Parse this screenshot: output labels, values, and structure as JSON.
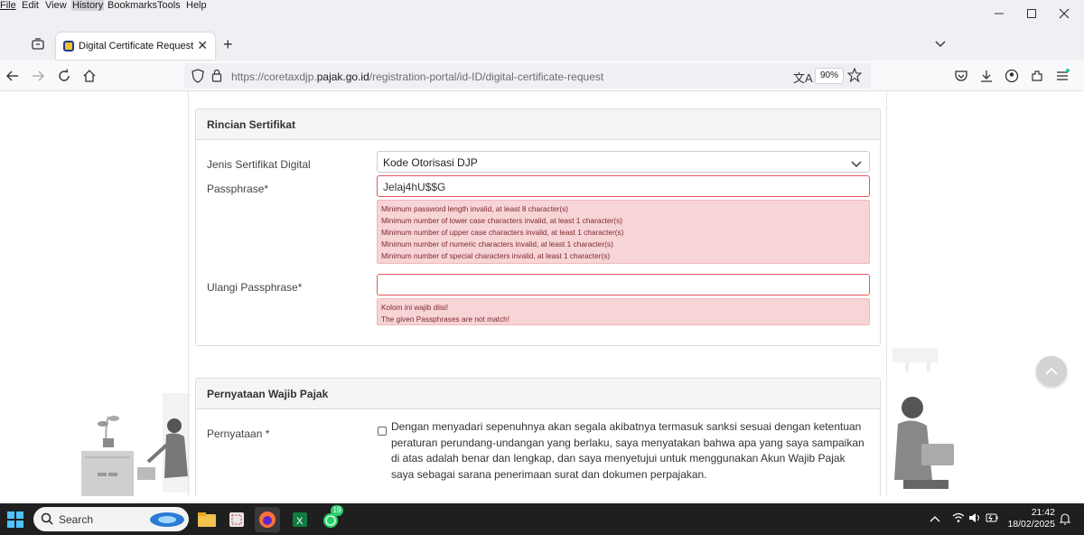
{
  "menu": {
    "items": [
      "File",
      "Edit",
      "View",
      "History",
      "Bookmarks",
      "Tools",
      "Help"
    ]
  },
  "browser": {
    "tab_title": "Digital Certificate Request",
    "url_prefix": "https://coretaxdjp.",
    "url_domain": "pajak.go.id",
    "url_path": "/registration-portal/id-ID/digital-certificate-request",
    "zoom": "90%"
  },
  "rincian": {
    "header": "Rincian Sertifikat",
    "jenis_label": "Jenis Sertifikat Digital",
    "jenis_value": "Kode Otorisasi DJP",
    "passphrase_label": "Passphrase*",
    "passphrase_value": "Jelaj4hU$$G",
    "passphrase_errors": [
      "Minimum password length invalid, at least 8 character(s)",
      "Minimum number of lower case characters invalid, at least 1 character(s)",
      "Minimum number of upper case characters invalid, at least 1 character(s)",
      "Minimum number of numeric characters invalid, at least 1 character(s)",
      "Minimum number of special characters invalid, at least 1 character(s)"
    ],
    "ulangi_label": "Ulangi Passphrase*",
    "ulangi_value": "",
    "ulangi_errors": [
      "Kolom ini wajib diisi!",
      "The given Passphrases are not match!"
    ]
  },
  "pernyataan": {
    "header": "Pernyataan Wajib Pajak",
    "label": "Pernyataan *",
    "text": "Dengan menyadari sepenuhnya akan segala akibatnya termasuk sanksi sesuai dengan ketentuan peraturan perundang-undangan yang berlaku, saya menyatakan bahwa apa yang saya sampaikan di atas adalah benar dan lengkap, dan saya menyetujui untuk menggunakan Akun Wajib Pajak saya sebagai sarana penerimaan surat dan dokumen perpajakan.",
    "checked": false
  },
  "taskbar": {
    "search_placeholder": "Search",
    "whatsapp_badge": "19",
    "time": "21:42",
    "date": "18/02/2025"
  },
  "colors": {
    "error_bg": "#f7d4d6",
    "error_border": "#e4585c",
    "taskbar": "#1f1f1f"
  }
}
